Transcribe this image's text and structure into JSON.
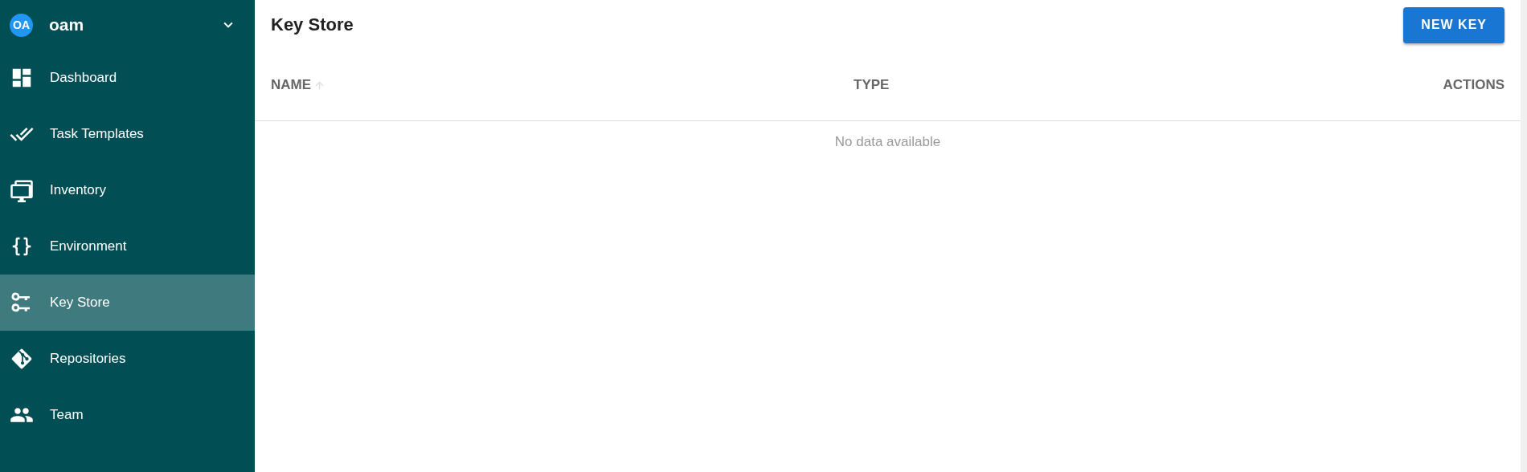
{
  "project": {
    "avatar": "OA",
    "name": "oam"
  },
  "sidebar": {
    "items": [
      {
        "label": "Dashboard",
        "selected": false
      },
      {
        "label": "Task Templates",
        "selected": false
      },
      {
        "label": "Inventory",
        "selected": false
      },
      {
        "label": "Environment",
        "selected": false
      },
      {
        "label": "Key Store",
        "selected": true
      },
      {
        "label": "Repositories",
        "selected": false
      },
      {
        "label": "Team",
        "selected": false
      }
    ]
  },
  "page": {
    "title": "Key Store",
    "new_button": "NEW KEY"
  },
  "table": {
    "columns": [
      {
        "label": "NAME",
        "sorted": true
      },
      {
        "label": "TYPE",
        "sorted": false
      },
      {
        "label": "ACTIONS",
        "sorted": false
      }
    ],
    "empty_text": "No data available"
  }
}
